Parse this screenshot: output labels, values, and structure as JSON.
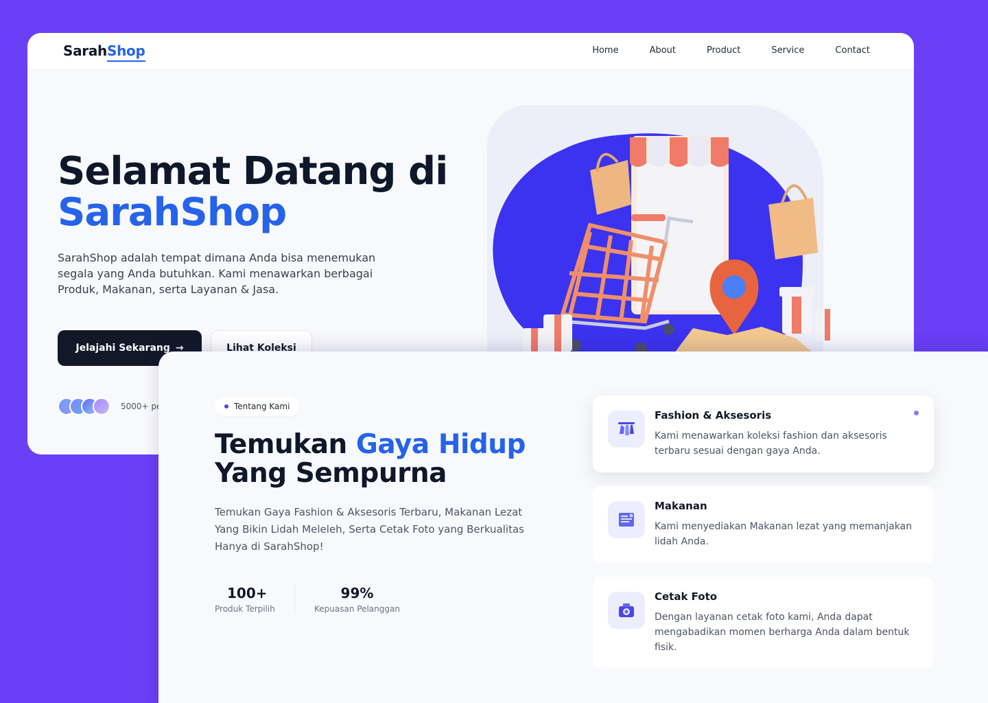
{
  "header": {
    "logo_part1": "Sarah",
    "logo_part2": "Shop",
    "nav": [
      "Home",
      "About",
      "Product",
      "Service",
      "Contact"
    ]
  },
  "hero": {
    "title_line1": "Selamat Datang di",
    "title_line2": "SarahShop",
    "description": "SarahShop adalah tempat dimana Anda bisa menemukan segala yang Anda butuhkan. Kami menawarkan berbagai Produk, Makanan, serta Layanan & Jasa.",
    "primary_button": "Jelajahi Sekarang",
    "primary_button_icon": "→",
    "secondary_button": "Lihat Koleksi",
    "social_proof": "5000+ pe"
  },
  "about": {
    "badge": "Tentang Kami",
    "title_part1": "Temukan ",
    "title_accent": "Gaya Hidup",
    "title_part2": "Yang Sempurna",
    "description": "Temukan Gaya Fashion & Aksesoris Terbaru, Makanan Lezat Yang Bikin Lidah Meleleh, Serta Cetak Foto yang Berkualitas Hanya di SarahShop!",
    "stats": [
      {
        "value": "100+",
        "label": "Produk Terpilih"
      },
      {
        "value": "99%",
        "label": "Kepuasan Pelanggan"
      }
    ],
    "services": [
      {
        "icon": "clothes-rack-icon",
        "title": "Fashion & Aksesoris",
        "description": "Kami menawarkan koleksi fashion dan aksesoris terbaru sesuai dengan gaya Anda."
      },
      {
        "icon": "food-menu-icon",
        "title": "Makanan",
        "description": "Kami menyediakan Makanan lezat yang memanjakan lidah Anda."
      },
      {
        "icon": "camera-print-icon",
        "title": "Cetak Foto",
        "description": "Dengan layanan cetak foto kami, Anda dapat mengabadikan momen berharga Anda dalam bentuk fisik."
      }
    ]
  },
  "colors": {
    "page_background": "#6a3ff5",
    "accent": "#2563eb",
    "dark": "#0f172a"
  }
}
